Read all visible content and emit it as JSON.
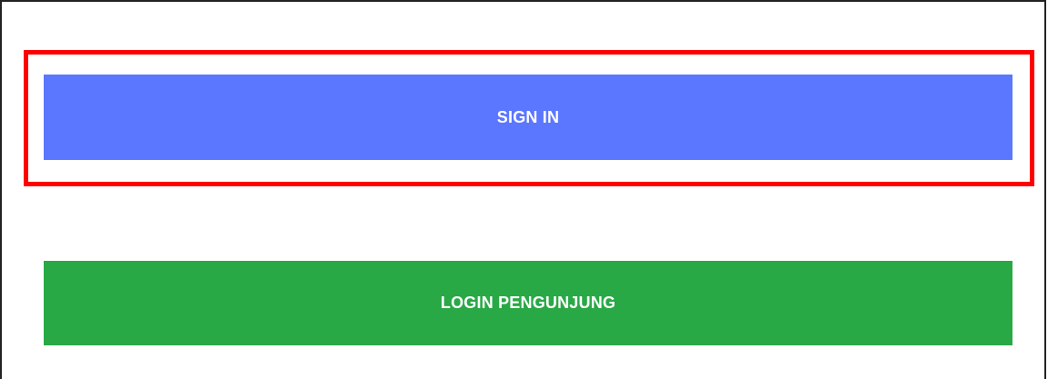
{
  "buttons": {
    "sign_in": {
      "label": "SIGN IN",
      "color": "#5b76ff"
    },
    "visitor_login": {
      "label": "LOGIN PENGUNJUNG",
      "color": "#29a846"
    }
  },
  "highlight": {
    "color": "#ff0000",
    "target": "sign-in-button"
  }
}
